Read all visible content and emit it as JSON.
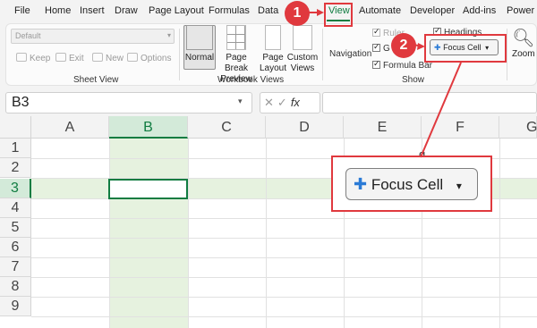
{
  "menu": [
    {
      "label": "File"
    },
    {
      "label": "Home"
    },
    {
      "label": "Insert"
    },
    {
      "label": "Draw"
    },
    {
      "label": "Page Layout"
    },
    {
      "label": "Formulas"
    },
    {
      "label": "Data"
    },
    {
      "label": "View"
    },
    {
      "label": "Automate"
    },
    {
      "label": "Developer"
    },
    {
      "label": "Add-ins"
    },
    {
      "label": "Power P"
    }
  ],
  "sheet_view": {
    "select_value": "Default",
    "keep": "Keep",
    "exit": "Exit",
    "new": "New",
    "options": "Options",
    "group_label": "Sheet View"
  },
  "workbook_views": {
    "normal": "Normal",
    "page_break_1": "Page Break",
    "page_break_2": "Preview",
    "page_layout_1": "Page",
    "page_layout_2": "Layout",
    "custom_1": "Custom",
    "custom_2": "Views",
    "group_label": "Workbook Views"
  },
  "show": {
    "navigation": "Navigation",
    "ruler": "Ruler",
    "gridlines": "G",
    "formula_bar": "Formula Bar",
    "headings": "Headings",
    "focus_cell": "Focus Cell",
    "group_label": "Show"
  },
  "zoom": {
    "label": "Zoom"
  },
  "formula_bar": {
    "name_box": "B3",
    "fx": "fx"
  },
  "columns": [
    "A",
    "B",
    "C",
    "D",
    "E",
    "F",
    "G"
  ],
  "rows": [
    "1",
    "2",
    "3",
    "4",
    "5",
    "6",
    "7",
    "8",
    "9"
  ],
  "callout": {
    "focus_cell_label": "Focus Cell",
    "badge_1": "1",
    "badge_2": "2",
    "partial_char": "g"
  },
  "colors": {
    "accent": "#107c41",
    "highlight": "#e6f2df",
    "annotation": "#e0393e"
  }
}
